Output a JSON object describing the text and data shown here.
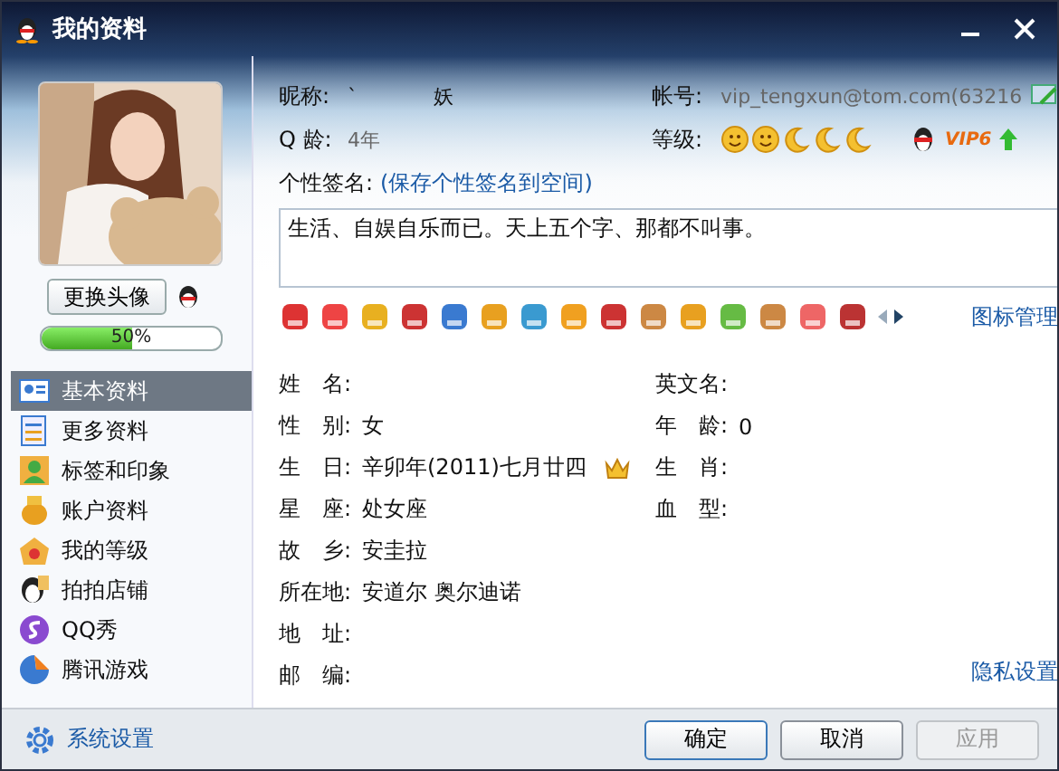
{
  "window": {
    "title": "我的资料"
  },
  "change_avatar_button": "更换头像",
  "completion": {
    "level": 0.5,
    "reading": "50%"
  },
  "sidebar": {
    "items": [
      {
        "label": "基本资料",
        "selected": true
      },
      {
        "label": "更多资料",
        "selected": false
      },
      {
        "label": "标签和印象",
        "selected": false
      },
      {
        "label": "账户资料",
        "selected": false
      },
      {
        "label": "我的等级",
        "selected": false
      },
      {
        "label": "拍拍店铺",
        "selected": false
      },
      {
        "label": "QQ秀",
        "selected": false
      },
      {
        "label": "腾讯游戏",
        "selected": false
      }
    ]
  },
  "system_settings": "系统设置",
  "header": {
    "nickname_label": "昵称:",
    "nickname": "`            妖",
    "account_label": "帐号:",
    "account": "vip_tengxun@tom.com(63216",
    "age_label": "Q 龄:",
    "age": "4年",
    "level_label": "等级:",
    "level_icons": [
      {
        "kind": "sun"
      },
      {
        "kind": "sun"
      },
      {
        "kind": "moon"
      },
      {
        "kind": "moon"
      },
      {
        "kind": "moon"
      }
    ],
    "vip": "VIP6"
  },
  "signature": {
    "label": "个性签名:",
    "link": "(保存个性签名到空间)",
    "text": "生活、自娱自乐而已。天上五个字、那都不叫事。"
  },
  "icon_manage_link": "图标管理",
  "left_fields": [
    {
      "label": "姓　名:"
    },
    {
      "label": "性　别:",
      "value": "女"
    },
    {
      "label": "生　日:",
      "value": "辛卯年(2011)七月廿四",
      "crown": true
    },
    {
      "label": "星　座:",
      "value": "处女座"
    },
    {
      "label": "故　乡:",
      "value": "安圭拉"
    },
    {
      "label": "所在地:",
      "value": "安道尔 奥尔迪诺"
    },
    {
      "label": "地　址:"
    },
    {
      "label": "邮　编:"
    }
  ],
  "right_fields": [
    {
      "label": "英文名:"
    },
    {
      "label": "年　龄:",
      "value": "0"
    },
    {
      "label": "生　肖:"
    },
    {
      "label": "血　型:"
    }
  ],
  "privacy_link": "隐私设置",
  "buttons": [
    {
      "label": "确定",
      "disabled": false,
      "default": true
    },
    {
      "label": "取消",
      "disabled": false,
      "default": false
    },
    {
      "label": "应用",
      "disabled": true,
      "default": false
    }
  ]
}
